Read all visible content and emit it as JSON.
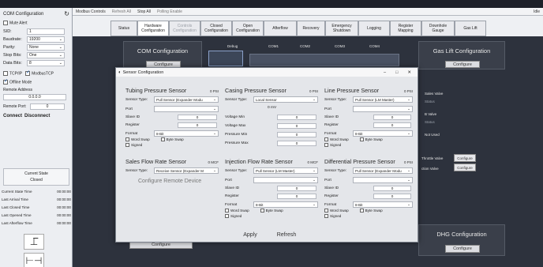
{
  "titlebar": {
    "modbus_label": "Modbus Controls",
    "idle": "Idle"
  },
  "ribbon": {
    "refresh_all": "Refresh All",
    "stop_all": "Stop All",
    "polling_enable": "Polling Enable"
  },
  "left": {
    "header": "COM Configuration",
    "mute_alert": "Mute Alert",
    "fields": [
      {
        "label": "SID:",
        "value": "1"
      },
      {
        "label": "Baudrate:",
        "value": "19200"
      },
      {
        "label": "Parity:",
        "value": "None"
      },
      {
        "label": "Stop Bits:",
        "value": "One"
      },
      {
        "label": "Data Bits:",
        "value": "8"
      }
    ],
    "tcpip": "TCP/IP",
    "modbustcp": "ModbusTCP",
    "offline_mode": "Offline Mode",
    "remote_address_label": "Remote Address",
    "remote_address_value": "0.0.0.0",
    "remote_port_label": "Remote Port:",
    "remote_port_value": "0",
    "connect": "Connect",
    "disconnect": "Disconnect",
    "current_state_label": "Current State",
    "current_state_value": "Closed",
    "times": [
      {
        "label": "Current State Time",
        "value": "00:00:00"
      },
      {
        "label": "Last Arrival Time",
        "value": "00:00:00"
      },
      {
        "label": "Last Closed Time",
        "value": "00:00:00"
      },
      {
        "label": "Last Opened Time",
        "value": "00:00:00"
      },
      {
        "label": "Last Afterflow Time",
        "value": "00:00:00"
      }
    ]
  },
  "tabs": [
    {
      "label": "Status"
    },
    {
      "label": "Hardware Configuration"
    },
    {
      "label": "Controls Configuration"
    },
    {
      "label": "Closed Configuration"
    },
    {
      "label": "Open Configuration"
    },
    {
      "label": "Afterflow"
    },
    {
      "label": "Recovery"
    },
    {
      "label": "Emergency Shutdown"
    },
    {
      "label": "Logging"
    },
    {
      "label": "Register Mapping"
    },
    {
      "label": "Downhole Gauge"
    },
    {
      "label": "Gas Lift"
    }
  ],
  "main": {
    "com_config_title": "COM Configuration",
    "configure": "Configure",
    "debug": "Debug",
    "com1": "COM1",
    "com2": "COM2",
    "com3": "COM3",
    "com4": "COM4",
    "gas_lift_title": "Gas Lift Configuration",
    "sales_valve": "Sales Valve",
    "status": "Status",
    "b_valve": "B Valve",
    "not_used": "Not Used",
    "throttle_valve": "Throttle Valve",
    "ction_valve": "ction Valve",
    "configure_small": "Configure",
    "dhg_title": "DHG Configuration",
    "bottom_configure": "Configure"
  },
  "dialog": {
    "title": "Sensor Configuration",
    "minimize": "–",
    "maximize": "□",
    "close": "✕",
    "tubing": {
      "title": "Tubing Pressure Sensor",
      "unit": "0 PSI",
      "sensor_type_label": "Sensor Type:",
      "sensor_type": "Pull Sensor (Expander Modu",
      "port_label": "Port",
      "slave_label": "Slave ID",
      "slave_value": "0",
      "register_label": "Register",
      "register_value": "0",
      "format_label": "Format",
      "format_value": "8-Bit",
      "word_swap": "Word Swap",
      "byte_swap": "Byte Swap",
      "signed": "Signed"
    },
    "casing": {
      "title": "Casing Pressure Sensor",
      "unit": "0 PSI",
      "sensor_type_label": "Sensor Type:",
      "sensor_type": "Local Sensor",
      "mv": "0 mV",
      "voltage_min_label": "Voltage Min",
      "voltage_min": "0",
      "voltage_max_label": "Voltage Max",
      "voltage_max": "0",
      "pressure_min_label": "Pressure Min",
      "pressure_min": "0",
      "pressure_max_label": "Pressure Max",
      "pressure_max": "0"
    },
    "line": {
      "title": "Line Pressure Sensor",
      "unit": "0 PSI",
      "sensor_type_label": "Sensor Type:",
      "sensor_type": "Pull Sensor (LM Master)",
      "port_label": "Port",
      "slave_label": "Slave ID",
      "slave_value": "0",
      "register_label": "Register",
      "register_value": "0",
      "format_label": "Format",
      "format_value": "8-Bit",
      "word_swap": "Word Swap",
      "byte_swap": "Byte Swap",
      "signed": "Signed"
    },
    "sales": {
      "title": "Sales Flow Rate Sensor",
      "unit": "0 MCF",
      "sensor_type_label": "Sensor Type:",
      "sensor_type": "Receive Sensor (Expander M",
      "configure_remote": "Configure Remote Device"
    },
    "injection": {
      "title": "Injection Flow Rate Sensor",
      "unit": "0 MCF",
      "sensor_type_label": "Sensor Type:",
      "sensor_type": "Pull Sensor (LM Master)",
      "port_label": "Port",
      "slave_label": "Slave ID",
      "slave_value": "0",
      "register_label": "Register",
      "register_value": "0",
      "format_label": "Format",
      "format_value": "8-Bit",
      "word_swap": "Word Swap",
      "byte_swap": "Byte Swap",
      "signed": "Signed"
    },
    "differential": {
      "title": "Differential Pressure Sensor",
      "unit": "0 PSI",
      "sensor_type_label": "Sensor Type:",
      "sensor_type": "Pull Sensor (Expander Modu",
      "port_label": "Port",
      "slave_label": "Slave ID",
      "slave_value": "0",
      "register_label": "Register",
      "register_value": "0",
      "format_label": "Format",
      "format_value": "8-Bit",
      "word_swap": "Word Swap",
      "byte_swap": "Byte Swap",
      "signed": "Signed"
    },
    "apply": "Apply",
    "refresh": "Refresh"
  }
}
